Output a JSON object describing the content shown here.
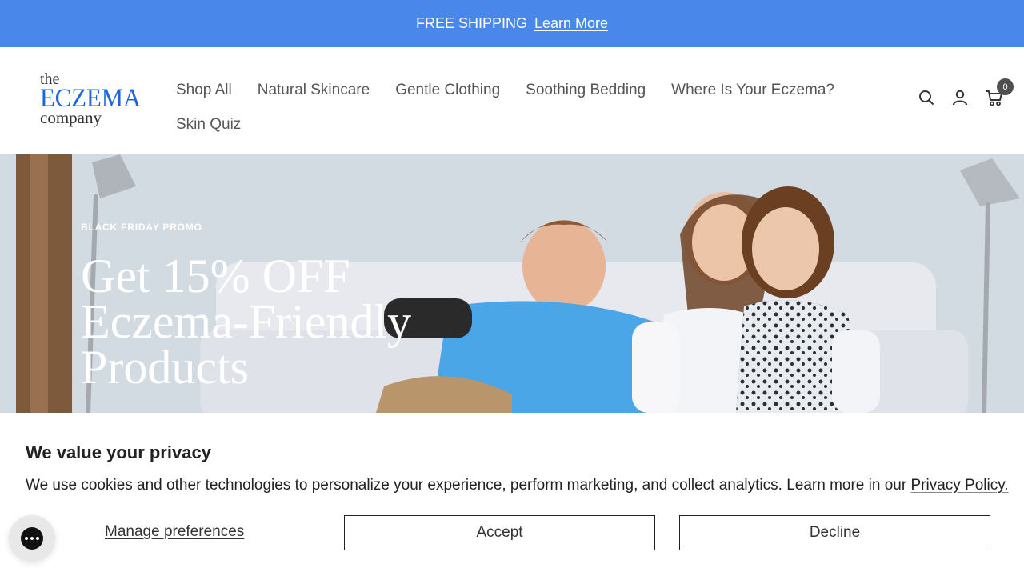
{
  "announcement": {
    "text": "FREE SHIPPING",
    "link": "Learn More"
  },
  "logo": {
    "line1": "the",
    "line2": "ECZEMA",
    "line3": "company"
  },
  "nav": {
    "row1": [
      "Shop All",
      "Natural Skincare",
      "Gentle Clothing",
      "Soothing Bedding",
      "Where Is Your Eczema?"
    ],
    "row2": [
      "Skin Quiz"
    ]
  },
  "header_icons": [
    "search-icon",
    "account-icon",
    "cart-icon"
  ],
  "cart": {
    "count": "0"
  },
  "hero": {
    "eyebrow": "BLACK FRIDAY PROMO",
    "title_line1": "Get 15% OFF",
    "title_line2": "Eczema-Friendly",
    "title_line3": "Products"
  },
  "cookie": {
    "title": "We value your privacy",
    "text": "We use cookies and other technologies to personalize your experience, perform marketing, and collect analytics. Learn more in our ",
    "policy_link": "Privacy Policy.",
    "manage": "Manage preferences",
    "accept": "Accept",
    "decline": "Decline"
  },
  "colors": {
    "announcement_bg": "#4a87ea",
    "brand_blue": "#1e64e0"
  }
}
